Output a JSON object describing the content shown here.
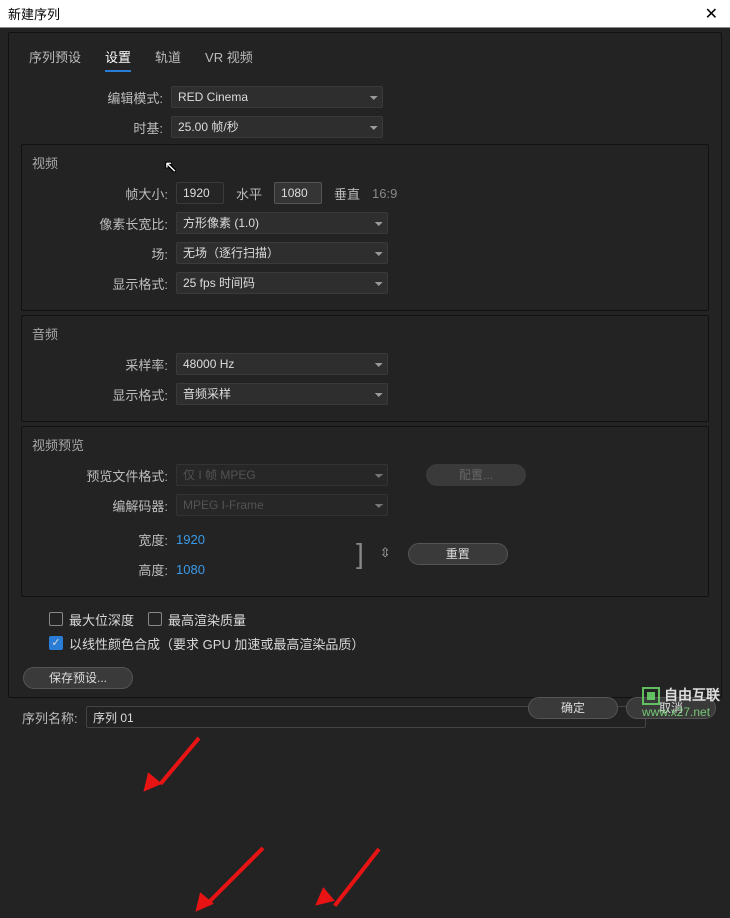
{
  "title": "新建序列",
  "tabs": {
    "preset": "序列预设",
    "settings": "设置",
    "tracks": "轨道",
    "vr": "VR 视频"
  },
  "edit": {
    "modeLabel": "编辑模式:",
    "modeValue": "RED Cinema",
    "timebaseLabel": "时基:",
    "timebaseValue": "25.00 帧/秒"
  },
  "video": {
    "heading": "视频",
    "frameSizeLabel": "帧大小:",
    "width": "1920",
    "hLabel": "水平",
    "height": "1080",
    "vLabel": "垂直",
    "aspect": "16:9",
    "parLabel": "像素长宽比:",
    "parValue": "方形像素 (1.0)",
    "fieldsLabel": "场:",
    "fieldsValue": "无场（逐行扫描）",
    "dispLabel": "显示格式:",
    "dispValue": "25 fps 时间码"
  },
  "audio": {
    "heading": "音频",
    "rateLabel": "采样率:",
    "rateValue": "48000 Hz",
    "dispLabel": "显示格式:",
    "dispValue": "音频采样"
  },
  "preview": {
    "heading": "视频预览",
    "fileFmtLabel": "预览文件格式:",
    "fileFmtValue": "仅 I 帧 MPEG",
    "codecLabel": "编解码器:",
    "codecValue": "MPEG I-Frame",
    "widthLabel": "宽度:",
    "widthValue": "1920",
    "heightLabel": "高度:",
    "heightValue": "1080",
    "configure": "配置...",
    "reset": "重置"
  },
  "checks": {
    "maxBit": "最大位深度",
    "maxRender": "最高渲染质量",
    "linear": "以线性颜色合成（要求 GPU 加速或最高渲染品质）"
  },
  "savePreset": "保存预设...",
  "seqNameLabel": "序列名称:",
  "seqNameValue": "序列 01",
  "ok": "确定",
  "cancel": "取消",
  "watermark": {
    "text": "自由互联",
    "url": "www.x27.net"
  }
}
